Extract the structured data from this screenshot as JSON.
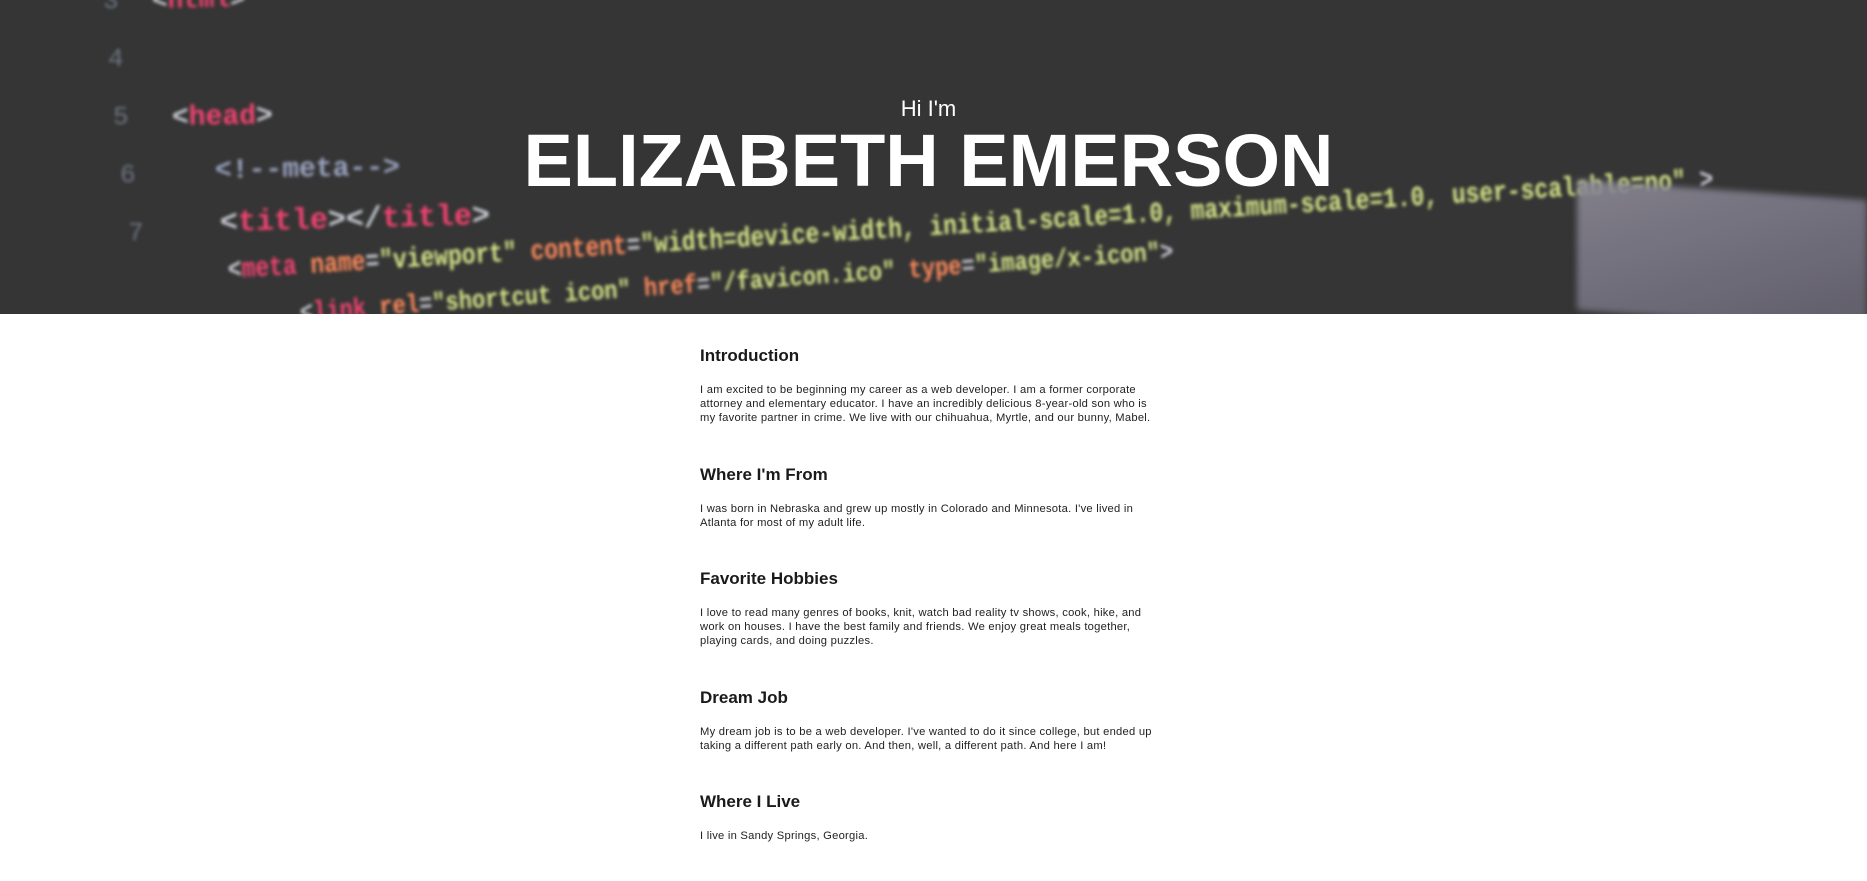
{
  "hero": {
    "greeting": "Hi I'm",
    "name": "ELIZABETH EMERSON",
    "background_code": {
      "line_numbers": [
        "3",
        "4",
        "5",
        "6",
        "7"
      ],
      "lines": [
        {
          "parts": [
            [
              "<",
              "c-br"
            ],
            [
              "html",
              "c-tag"
            ],
            [
              ">",
              "c-br"
            ]
          ]
        },
        {
          "parts": [
            [
              "<",
              "c-br"
            ],
            [
              "head",
              "c-tag"
            ],
            [
              ">",
              "c-br"
            ]
          ]
        },
        {
          "parts": [
            [
              "<!--meta-->",
              "c-cm"
            ]
          ]
        },
        {
          "parts": [
            [
              "<",
              "c-br"
            ],
            [
              "title",
              "c-tag"
            ],
            [
              "></",
              "c-br"
            ],
            [
              "title",
              "c-tag"
            ],
            [
              ">",
              "c-br"
            ]
          ]
        },
        {
          "parts": [
            [
              "<",
              "c-br"
            ],
            [
              "meta ",
              "c-tag"
            ],
            [
              "name",
              "c-attr"
            ],
            [
              "=",
              "c-br"
            ],
            [
              "\"viewport\" ",
              "c-str"
            ],
            [
              "content",
              "c-attr"
            ],
            [
              "=",
              "c-br"
            ],
            [
              "\"width=device-width, initial-scale=1.0, maximum-scale=1.0, user-scalable=no\" ",
              "c-str"
            ],
            [
              ">",
              "c-br"
            ]
          ]
        },
        {
          "parts": [
            [
              "<",
              "c-br"
            ],
            [
              "link ",
              "c-tag"
            ],
            [
              "rel",
              "c-attr"
            ],
            [
              "=",
              "c-br"
            ],
            [
              "\"shortcut icon\" ",
              "c-str"
            ],
            [
              "href",
              "c-attr"
            ],
            [
              "=",
              "c-br"
            ],
            [
              "\"/favicon.ico\" ",
              "c-str"
            ],
            [
              "type",
              "c-attr"
            ],
            [
              "=",
              "c-br"
            ],
            [
              "\"image/x-icon\"",
              "c-str"
            ],
            [
              ">",
              "c-br"
            ]
          ]
        }
      ]
    }
  },
  "sections": [
    {
      "title": "Introduction",
      "body": "I am excited to be beginning my career as a web developer. I am a former corporate attorney and elementary educator. I have an incredibly delicious 8-year-old son who is my favorite partner in crime. We live with our chihuahua, Myrtle, and our bunny, Mabel."
    },
    {
      "title": "Where I'm From",
      "body": "I was born in Nebraska and grew up mostly in Colorado and Minnesota. I've lived in Atlanta for most of my adult life."
    },
    {
      "title": "Favorite Hobbies",
      "body": "I love to read many genres of books, knit, watch bad reality tv shows, cook, hike, and work on houses. I have the best family and friends. We enjoy great meals together, playing cards, and doing puzzles."
    },
    {
      "title": "Dream Job",
      "body": "My dream job is to be a web developer. I've wanted to do it since college, but ended up taking a different path early on. And then, well, a different path. And here I am!"
    },
    {
      "title": "Where I Live",
      "body": "I live in Sandy Springs, Georgia."
    }
  ]
}
